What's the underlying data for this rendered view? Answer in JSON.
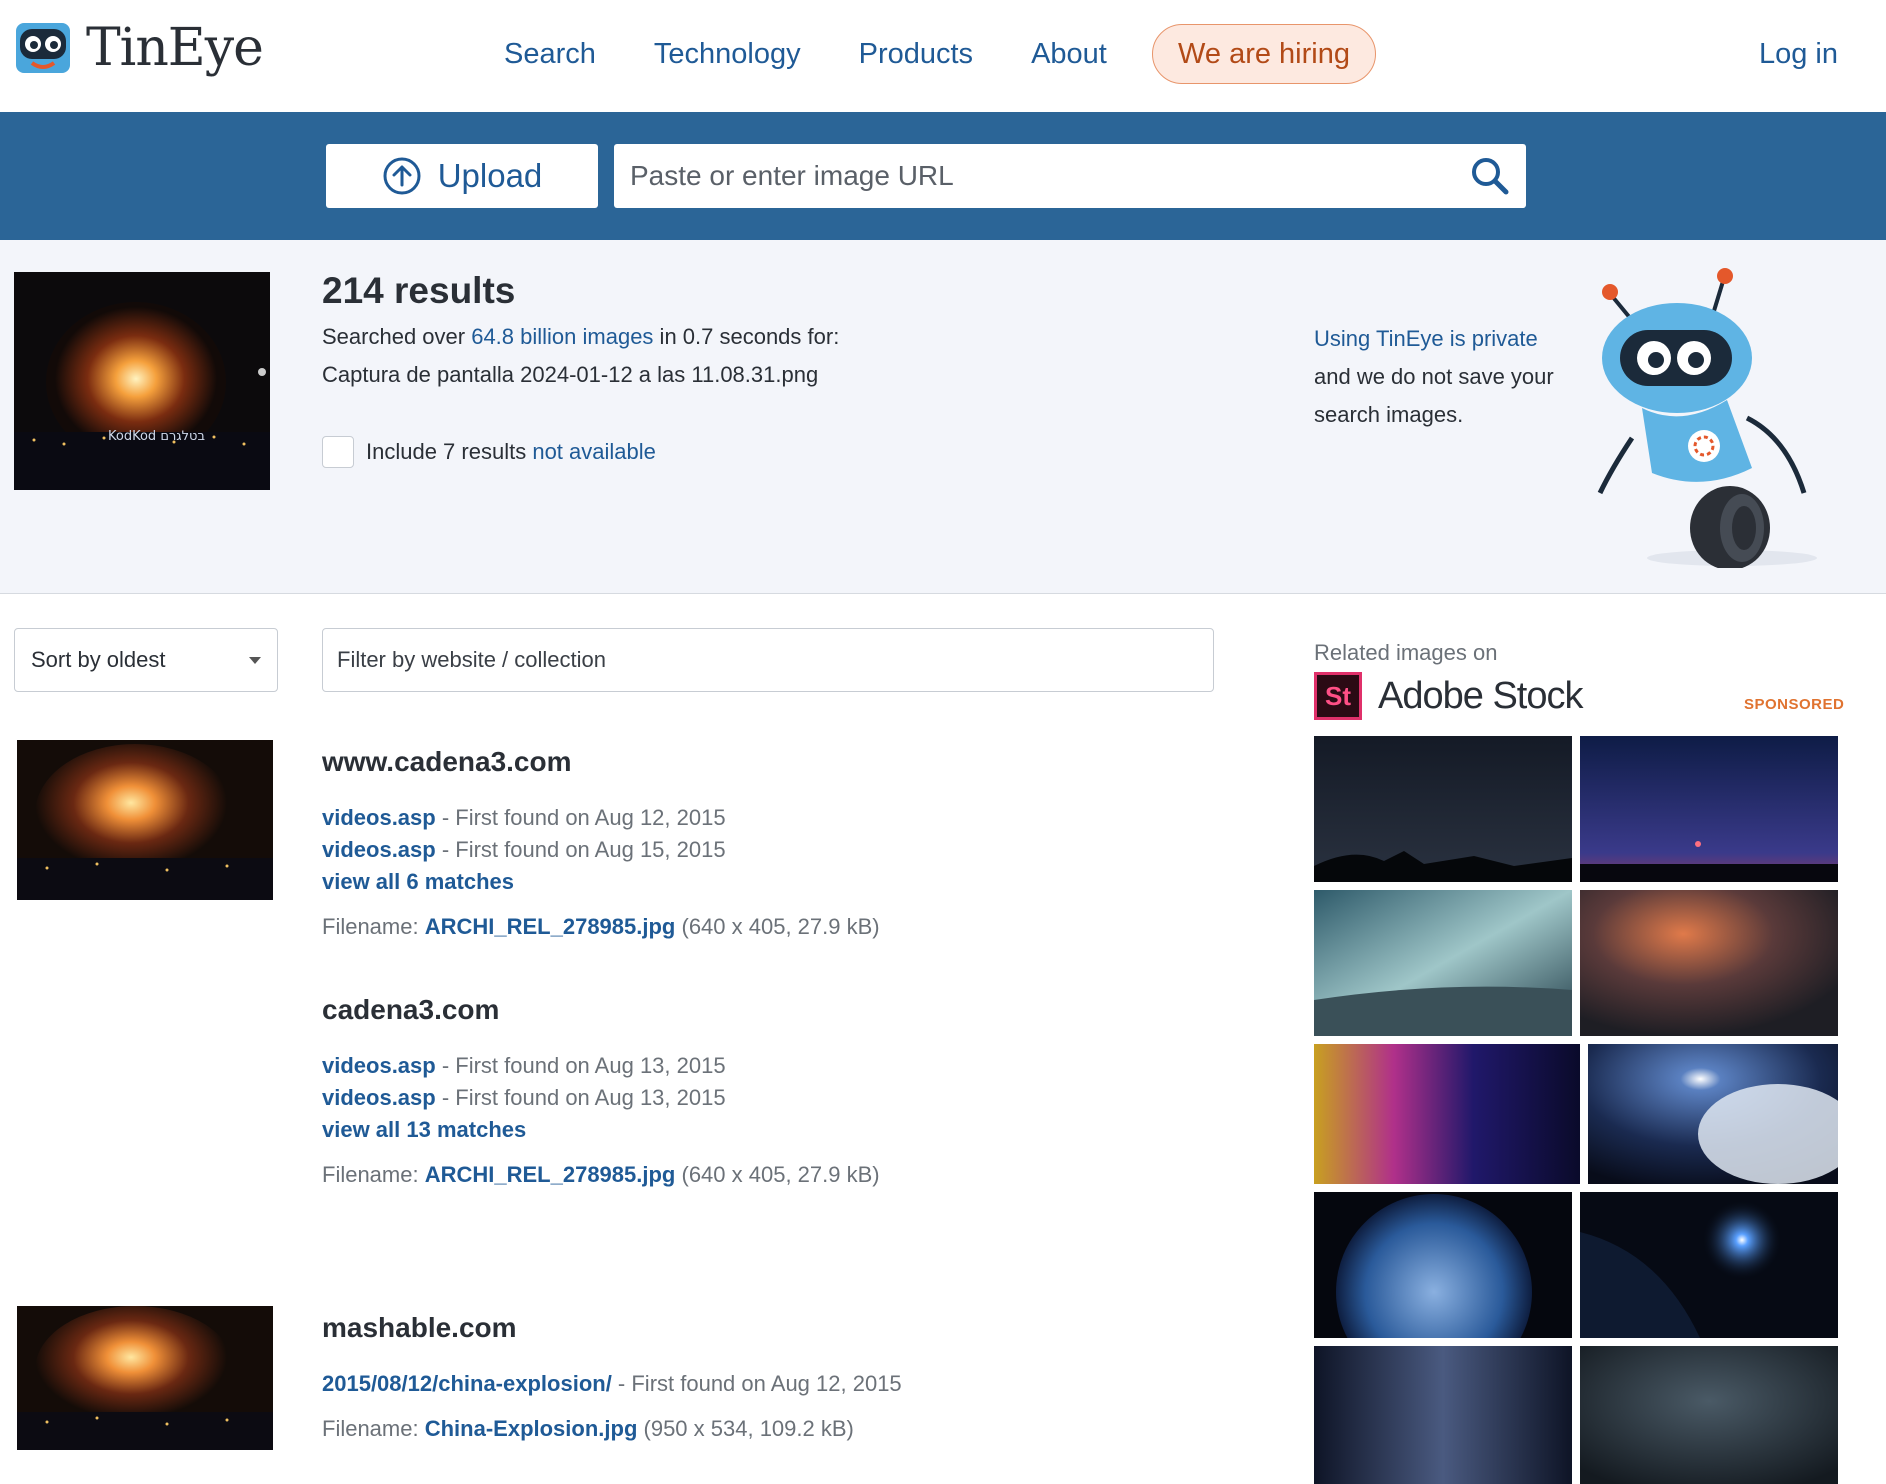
{
  "header": {
    "logo_text": "TinEye",
    "nav": [
      "Search",
      "Technology",
      "Products",
      "About"
    ],
    "hiring_label": "We are hiring",
    "login_label": "Log in"
  },
  "searchbar": {
    "upload_label": "Upload",
    "url_placeholder": "Paste or enter image URL"
  },
  "summary": {
    "results_count": "214 results",
    "searched_prefix": "Searched over ",
    "searched_link": "64.8 billion images",
    "searched_suffix": " in 0.7 seconds for:",
    "query_filename": "Captura de pantalla 2024-01-12 a las 11.08.31.png",
    "include_prefix": "Include 7 results ",
    "include_link": "not available",
    "thumb_watermark": "KodKod בטלגרם",
    "privacy_link": "Using TinEye is private",
    "privacy_text": "and we do not save your search images."
  },
  "filters": {
    "sort_label": "Sort by oldest",
    "filter_placeholder": "Filter by website / collection"
  },
  "results": [
    {
      "site": "www.cadena3.com",
      "matches": [
        {
          "link": "videos.asp",
          "found": " - First found on Aug 12, 2015"
        },
        {
          "link": "videos.asp",
          "found": " - First found on Aug 15, 2015"
        }
      ],
      "view_all": "view all 6 matches",
      "file_label": "Filename: ",
      "file_link": "ARCHI_REL_278985.jpg",
      "file_meta": " (640 x 405, 27.9 kB)"
    },
    {
      "site": "cadena3.com",
      "matches": [
        {
          "link": "videos.asp",
          "found": " - First found on Aug 13, 2015"
        },
        {
          "link": "videos.asp",
          "found": " - First found on Aug 13, 2015"
        }
      ],
      "view_all": "view all 13 matches",
      "file_label": "Filename: ",
      "file_link": "ARCHI_REL_278985.jpg",
      "file_meta": " (640 x 405, 27.9 kB)"
    },
    {
      "site": "mashable.com",
      "matches": [
        {
          "link": "2015/08/12/china-explosion/",
          "found": " - First found on Aug 12, 2015"
        }
      ],
      "file_label": "Filename: ",
      "file_link": "China-Explosion.jpg",
      "file_meta": " (950 x 534, 109.2 kB)"
    }
  ],
  "sidebar": {
    "related_label": "Related images on",
    "adobe_logo": "St",
    "adobe_text": "Adobe Stock",
    "sponsored": "SPONSORED"
  },
  "colors": {
    "brand_blue": "#2b6597",
    "link_blue": "#1f5a96",
    "hiring_bg": "#fde9e0",
    "hiring_text": "#b24a17",
    "summary_bg": "#f3f5fa"
  }
}
